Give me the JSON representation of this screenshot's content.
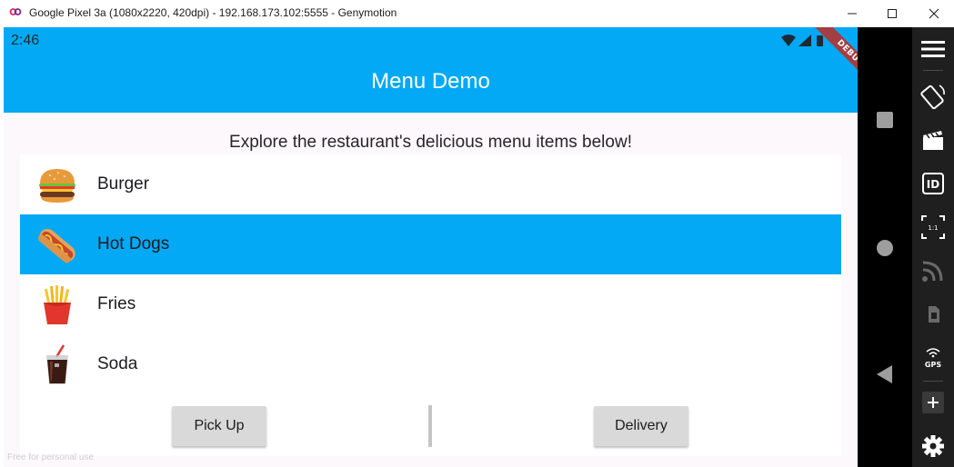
{
  "window": {
    "title": "Google Pixel 3a (1080x2220, 420dpi) - 192.168.173.102:5555 - Genymotion",
    "controls": [
      "minimize-icon",
      "maximize-icon",
      "close-icon"
    ]
  },
  "status_bar": {
    "time": "2:46",
    "icons": [
      "wifi-icon",
      "signal-icon",
      "battery-icon"
    ]
  },
  "app_bar": {
    "title": "Menu Demo",
    "debug_banner": "DEBUG"
  },
  "subtitle": "Explore the restaurant's delicious menu items below!",
  "menu_items": [
    {
      "label": "Burger",
      "icon": "burger-icon",
      "selected": false
    },
    {
      "label": "Hot Dogs",
      "icon": "hotdog-icon",
      "selected": true
    },
    {
      "label": "Fries",
      "icon": "fries-icon",
      "selected": false
    },
    {
      "label": "Soda",
      "icon": "soda-icon",
      "selected": false
    }
  ],
  "buttons": {
    "pickup": "Pick Up",
    "delivery": "Delivery"
  },
  "watermark": "Free for personal use",
  "android_nav": [
    "recents-icon",
    "home-icon",
    "back-icon"
  ],
  "genymotion_toolbar": [
    "menu-icon",
    "rotate-icon",
    "capture-icon",
    "identifiers-icon",
    "pixel-perfect-icon",
    "network-icon",
    "phone-icon",
    "gps-icon",
    "volume-up-icon",
    "settings-icon"
  ],
  "colors": {
    "primary": "#03a9f4",
    "debug": "#a33f43",
    "surface": "#fdf8fc",
    "button": "#d9d9d9"
  }
}
